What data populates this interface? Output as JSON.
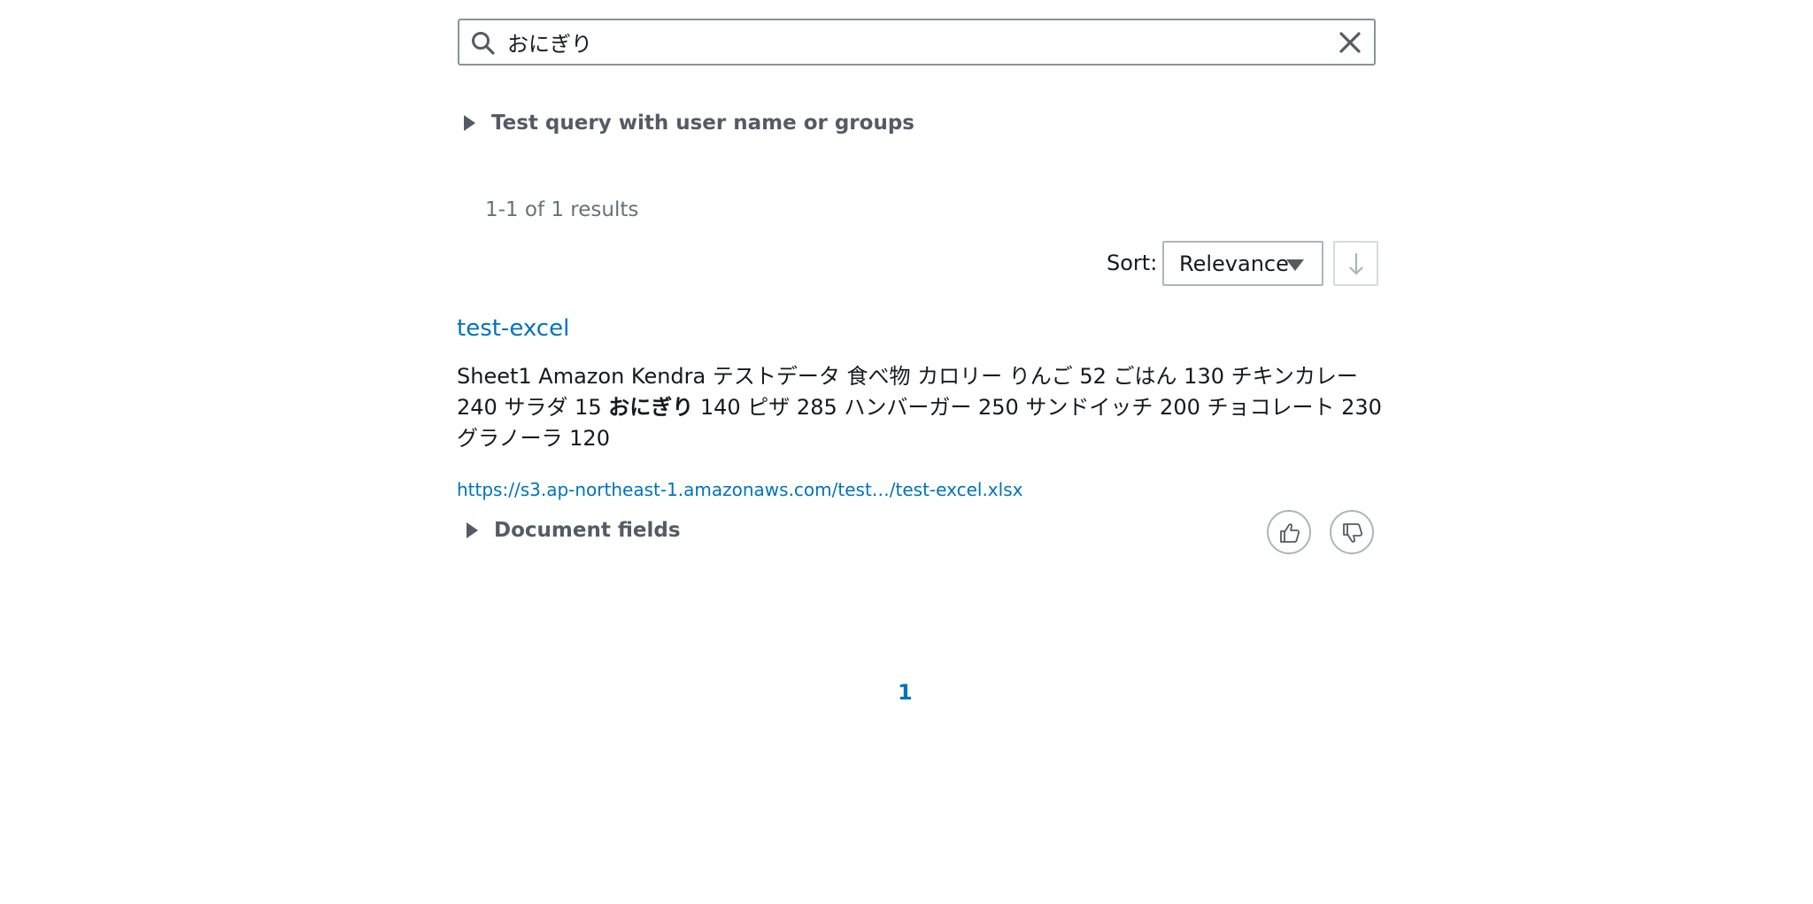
{
  "search": {
    "value": "おにぎり",
    "placeholder": ""
  },
  "test_query": {
    "label": "Test query with user name or groups"
  },
  "results": {
    "count_text": "1-1 of 1 results"
  },
  "sort": {
    "label": "Sort:",
    "selected": "Relevance"
  },
  "result": {
    "title": "test-excel",
    "excerpt_before": "Sheet1 Amazon Kendra テストデータ 食べ物 カロリー りんご 52 ごはん 130 チキンカレー 240 サラダ 15 ",
    "excerpt_highlight": "おにぎり",
    "excerpt_after": " 140 ピザ 285 ハンバーガー 250 サンドイッチ 200 チョコレート 230 グラノーラ 120",
    "url": "https://s3.ap-northeast-1.amazonaws.com/test…/test-excel.xlsx",
    "document_fields_label": "Document fields"
  },
  "pagination": {
    "current": "1"
  },
  "icons": {
    "search": "search-icon",
    "clear": "close-icon",
    "caret": "caret-right-icon",
    "sort_dropdown": "caret-down-icon",
    "sort_direction": "arrow-down-icon",
    "thumbs_up": "thumbs-up-icon",
    "thumbs_down": "thumbs-down-icon"
  },
  "colors": {
    "link": "#0073bb",
    "text": "#16191f",
    "secondary_text": "#545b64",
    "border": "#879596"
  }
}
